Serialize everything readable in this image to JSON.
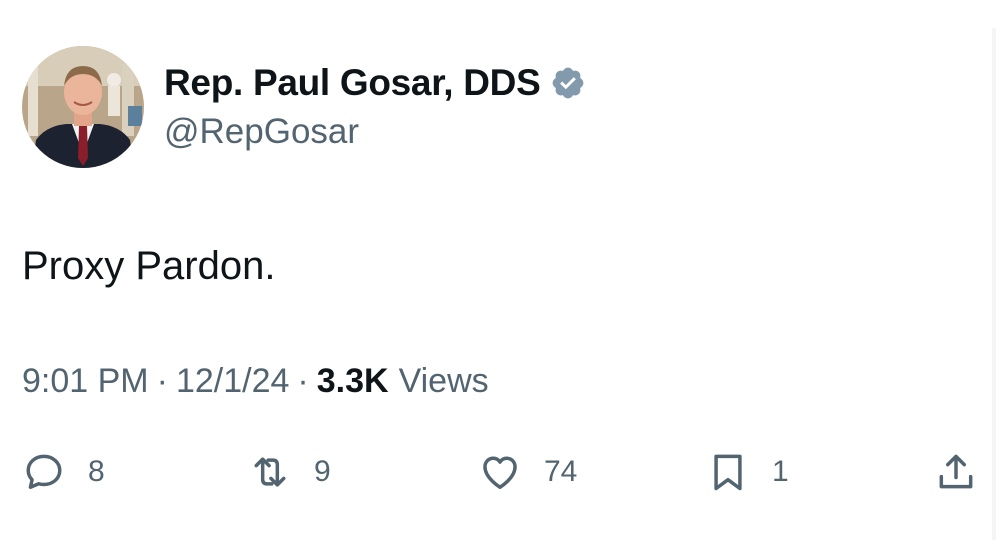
{
  "author": {
    "display_name": "Rep. Paul Gosar, DDS",
    "handle": "@RepGosar",
    "verified_badge_color": "#829aab",
    "avatar_icon": "profile-photo"
  },
  "tweet": {
    "text": "Proxy Pardon.",
    "time": "9:01 PM",
    "separator": "·",
    "date": "12/1/24",
    "views_count": "3.3K",
    "views_label": "Views"
  },
  "actions": {
    "reply": {
      "icon": "reply-icon",
      "count": "8"
    },
    "retweet": {
      "icon": "retweet-icon",
      "count": "9"
    },
    "like": {
      "icon": "heart-icon",
      "count": "74"
    },
    "bookmark": {
      "icon": "bookmark-icon",
      "count": "1"
    },
    "share": {
      "icon": "share-icon"
    }
  },
  "colors": {
    "text_primary": "#0f1419",
    "text_secondary": "#536471",
    "background": "#ffffff"
  }
}
